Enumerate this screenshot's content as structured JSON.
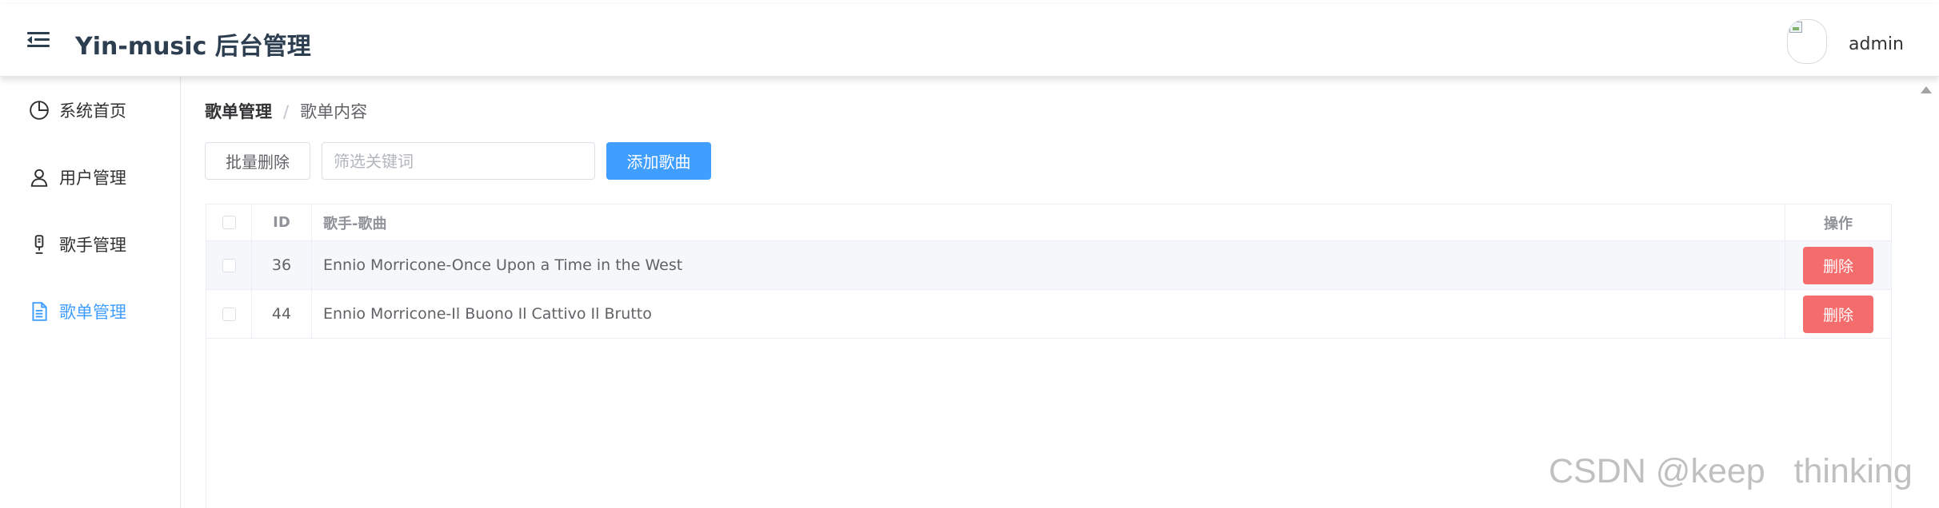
{
  "header": {
    "title": "Yin-music 后台管理",
    "username": "admin",
    "avatar_icon": "broken-image-icon",
    "menu_icon": "fold-menu-icon"
  },
  "sidebar": {
    "items": [
      {
        "label": "系统首页",
        "icon": "pie-chart-icon",
        "active": false
      },
      {
        "label": "用户管理",
        "icon": "user-icon",
        "active": false
      },
      {
        "label": "歌手管理",
        "icon": "microphone-icon",
        "active": false
      },
      {
        "label": "歌单管理",
        "icon": "document-icon",
        "active": true
      }
    ]
  },
  "breadcrumb": {
    "parent": "歌单管理",
    "separator": "/",
    "current": "歌单内容"
  },
  "toolbar": {
    "batch_delete_label": "批量删除",
    "search_placeholder": "筛选关键词",
    "search_value": "",
    "add_song_label": "添加歌曲"
  },
  "table": {
    "columns": [
      "",
      "ID",
      "歌手-歌曲",
      "操作"
    ],
    "rows": [
      {
        "id": "36",
        "song": "Ennio Morricone-Once Upon a Time in the West",
        "action": "删除"
      },
      {
        "id": "44",
        "song": "Ennio Morricone-Il Buono Il Cattivo Il Brutto",
        "action": "删除"
      }
    ]
  },
  "watermark": "CSDN @keep   thinking",
  "colors": {
    "primary": "#409eff",
    "danger": "#f56c6c",
    "title": "#2c3e50"
  }
}
